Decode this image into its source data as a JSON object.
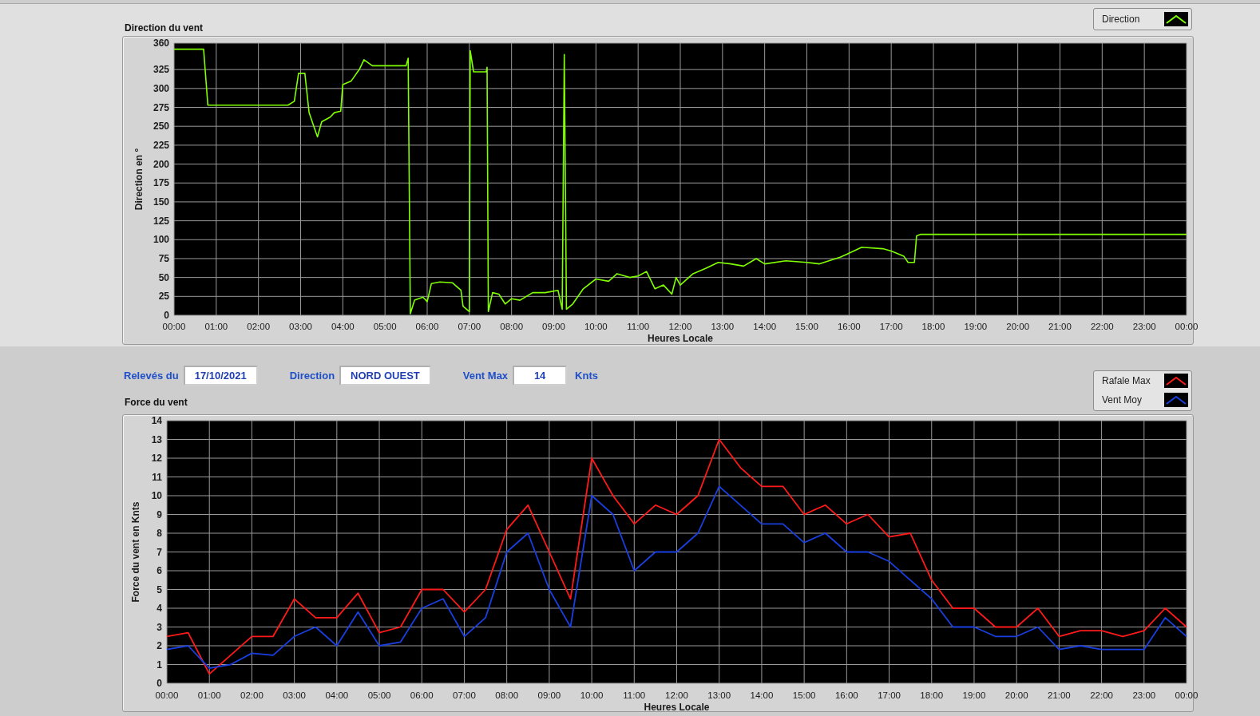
{
  "direction_chart": {
    "title": "Direction du vent",
    "chart_data": {
      "type": "line",
      "grid": true,
      "xlabel": "Heures Locale",
      "ylabel": "Direction en °",
      "xlim": [
        0,
        24
      ],
      "ylim": [
        0,
        360
      ],
      "x": [
        0,
        0.7,
        0.8,
        2.7,
        2.85,
        2.95,
        3.1,
        3.2,
        3.3,
        3.4,
        3.5,
        3.7,
        3.8,
        3.95,
        4.0,
        4.2,
        4.4,
        4.5,
        4.7,
        5.0,
        5.5,
        5.55,
        5.6,
        5.7,
        5.9,
        6.0,
        6.1,
        6.3,
        6.6,
        6.8,
        6.85,
        7.0,
        7.02,
        7.1,
        7.4,
        7.42,
        7.45,
        7.55,
        7.7,
        7.85,
        8.0,
        8.2,
        8.5,
        8.8,
        9.1,
        9.2,
        9.25,
        9.3,
        9.45,
        9.7,
        10.0,
        10.3,
        10.5,
        10.8,
        11.0,
        11.2,
        11.4,
        11.6,
        11.8,
        11.9,
        12.0,
        12.3,
        12.6,
        12.9,
        13.2,
        13.5,
        13.8,
        14.0,
        14.5,
        15.0,
        15.3,
        15.8,
        16.0,
        16.3,
        16.8,
        17.0,
        17.3,
        17.4,
        17.55,
        17.6,
        17.7,
        24
      ],
      "series": [
        {
          "name": "Direction",
          "color": "#80ff00",
          "values": [
            352,
            352,
            278,
            278,
            283,
            320,
            320,
            268,
            252,
            236,
            256,
            262,
            268,
            270,
            305,
            310,
            326,
            338,
            330,
            330,
            330,
            340,
            2,
            20,
            24,
            18,
            42,
            44,
            43,
            33,
            12,
            5,
            350,
            322,
            322,
            328,
            5,
            30,
            28,
            15,
            22,
            20,
            30,
            30,
            33,
            8,
            345,
            8,
            15,
            35,
            48,
            45,
            55,
            50,
            52,
            58,
            35,
            40,
            28,
            50,
            40,
            55,
            62,
            70,
            68,
            65,
            75,
            68,
            72,
            70,
            68,
            77,
            82,
            90,
            88,
            85,
            78,
            70,
            70,
            105,
            107,
            107
          ]
        }
      ],
      "xticks": [
        {
          "value": 0,
          "label": "00:00"
        },
        {
          "value": 1,
          "label": "01:00"
        },
        {
          "value": 2,
          "label": "02:00"
        },
        {
          "value": 3,
          "label": "03:00"
        },
        {
          "value": 4,
          "label": "04:00"
        },
        {
          "value": 5,
          "label": "05:00"
        },
        {
          "value": 6,
          "label": "06:00"
        },
        {
          "value": 7,
          "label": "07:00"
        },
        {
          "value": 8,
          "label": "08:00"
        },
        {
          "value": 9,
          "label": "09:00"
        },
        {
          "value": 10,
          "label": "10:00"
        },
        {
          "value": 11,
          "label": "11:00"
        },
        {
          "value": 12,
          "label": "12:00"
        },
        {
          "value": 13,
          "label": "13:00"
        },
        {
          "value": 14,
          "label": "14:00"
        },
        {
          "value": 15,
          "label": "15:00"
        },
        {
          "value": 16,
          "label": "16:00"
        },
        {
          "value": 17,
          "label": "17:00"
        },
        {
          "value": 18,
          "label": "18:00"
        },
        {
          "value": 19,
          "label": "19:00"
        },
        {
          "value": 20,
          "label": "20:00"
        },
        {
          "value": 21,
          "label": "21:00"
        },
        {
          "value": 22,
          "label": "22:00"
        },
        {
          "value": 23,
          "label": "23:00"
        },
        {
          "value": 24,
          "label": "00:00"
        }
      ],
      "yticks": [
        0,
        25,
        50,
        75,
        100,
        125,
        150,
        175,
        200,
        225,
        250,
        275,
        300,
        325,
        360
      ]
    }
  },
  "readings": [
    {
      "label": "Relevés du",
      "value": "17/10/2021"
    },
    {
      "label": "Direction",
      "value": "NORD OUEST"
    },
    {
      "label": "Vent Max",
      "value": "14",
      "unit": "Knts"
    }
  ],
  "force_chart": {
    "title": "Force du vent",
    "chart_data": {
      "type": "line",
      "grid": true,
      "xlabel": "Heures Locale",
      "ylabel": "Force du vent en Knts",
      "xlim": [
        0,
        24
      ],
      "ylim": [
        0,
        14
      ],
      "x": [
        0,
        0.5,
        1,
        1.5,
        2,
        2.5,
        3,
        3.5,
        4,
        4.5,
        5,
        5.5,
        6,
        6.5,
        7,
        7.5,
        8,
        8.5,
        9,
        9.5,
        10,
        10.5,
        11,
        11.5,
        12,
        12.5,
        13,
        13.5,
        14,
        14.5,
        15,
        15.5,
        16,
        16.5,
        17,
        17.5,
        18,
        18.5,
        19,
        19.5,
        20,
        20.5,
        21,
        21.5,
        22,
        22.5,
        23,
        23.5,
        24
      ],
      "series": [
        {
          "name": "Rafale Max",
          "color": "#ff1a1a",
          "values": [
            2.5,
            2.7,
            0.5,
            1.5,
            2.5,
            2.5,
            4.5,
            3.5,
            3.5,
            4.8,
            2.7,
            3,
            5,
            5,
            3.8,
            5,
            8.2,
            9.5,
            7,
            4.5,
            12,
            10,
            8.5,
            9.5,
            9,
            10,
            13,
            11.5,
            10.5,
            10.5,
            9,
            9.5,
            8.5,
            9,
            7.8,
            8,
            5.5,
            4,
            4,
            3,
            3,
            4,
            2.5,
            2.8,
            2.8,
            2.5,
            2.8,
            4,
            3
          ]
        },
        {
          "name": "Vent Moy",
          "color": "#1a3fe0",
          "values": [
            1.8,
            2,
            0.8,
            1,
            1.6,
            1.5,
            2.5,
            3,
            2,
            3.8,
            2,
            2.2,
            4,
            4.5,
            2.5,
            3.5,
            7,
            8,
            5,
            3,
            10,
            9,
            6,
            7,
            7,
            8,
            10.5,
            9.5,
            8.5,
            8.5,
            7.5,
            8,
            7,
            7,
            6.5,
            5.5,
            4.5,
            3,
            3,
            2.5,
            2.5,
            3,
            1.8,
            2,
            1.8,
            1.8,
            1.8,
            3.5,
            2.5
          ]
        }
      ],
      "xticks": [
        {
          "value": 0,
          "label": "00:00"
        },
        {
          "value": 1,
          "label": "01:00"
        },
        {
          "value": 2,
          "label": "02:00"
        },
        {
          "value": 3,
          "label": "03:00"
        },
        {
          "value": 4,
          "label": "04:00"
        },
        {
          "value": 5,
          "label": "05:00"
        },
        {
          "value": 6,
          "label": "06:00"
        },
        {
          "value": 7,
          "label": "07:00"
        },
        {
          "value": 8,
          "label": "08:00"
        },
        {
          "value": 9,
          "label": "09:00"
        },
        {
          "value": 10,
          "label": "10:00"
        },
        {
          "value": 11,
          "label": "11:00"
        },
        {
          "value": 12,
          "label": "12:00"
        },
        {
          "value": 13,
          "label": "13:00"
        },
        {
          "value": 14,
          "label": "14:00"
        },
        {
          "value": 15,
          "label": "15:00"
        },
        {
          "value": 16,
          "label": "16:00"
        },
        {
          "value": 17,
          "label": "17:00"
        },
        {
          "value": 18,
          "label": "18:00"
        },
        {
          "value": 19,
          "label": "19:00"
        },
        {
          "value": 20,
          "label": "20:00"
        },
        {
          "value": 21,
          "label": "21:00"
        },
        {
          "value": 22,
          "label": "22:00"
        },
        {
          "value": 23,
          "label": "23:00"
        },
        {
          "value": 24,
          "label": "00:00"
        }
      ],
      "yticks": [
        0,
        1,
        2,
        3,
        4,
        5,
        6,
        7,
        8,
        9,
        10,
        11,
        12,
        13,
        14
      ]
    }
  }
}
